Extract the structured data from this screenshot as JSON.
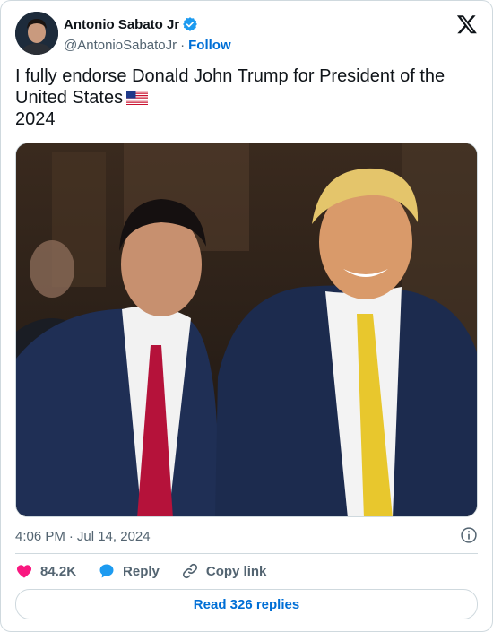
{
  "author": {
    "name": "Antonio Sabato Jr",
    "handle": "@AntonioSabatoJr",
    "separator": "·",
    "follow_label": "Follow"
  },
  "tweet": {
    "line1": "I fully endorse Donald John Trump for President of the",
    "line2": "United States",
    "line3": "2024"
  },
  "meta": {
    "time": "4:06 PM",
    "separator": "·",
    "date": "Jul 14, 2024"
  },
  "actions": {
    "like_count": "84.2K",
    "reply_label": "Reply",
    "copy_label": "Copy link"
  },
  "replies_button": "Read 326 replies",
  "colors": {
    "accent": "#006fd6",
    "like": "#f91880",
    "secondary_text": "#536471",
    "border": "#cfd9de"
  }
}
